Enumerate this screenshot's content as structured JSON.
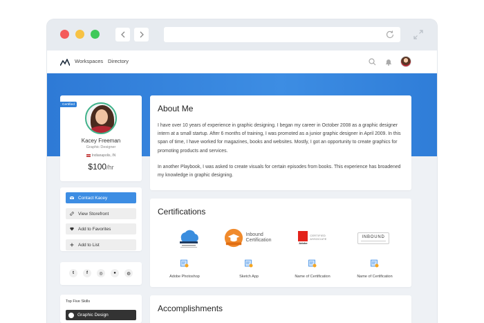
{
  "nav": {
    "workspaces": "Workspaces",
    "directory": "Directory"
  },
  "profile": {
    "badge": "Certified",
    "name": "Kacey Freeman",
    "title": "Graphic Designer",
    "location": "Indianapolis, IN",
    "rate": "$100",
    "rate_unit": "/hr"
  },
  "actions": [
    {
      "label": "Contact Kacey",
      "icon": "mail-icon",
      "primary": true
    },
    {
      "label": "View Storefront",
      "icon": "link-icon",
      "primary": false
    },
    {
      "label": "Add to Favorites",
      "icon": "heart-icon",
      "primary": false
    },
    {
      "label": "Add to List",
      "icon": "plus-icon",
      "primary": false
    }
  ],
  "social": [
    {
      "name": "twitter-icon",
      "glyph": "t"
    },
    {
      "name": "facebook-icon",
      "glyph": "f"
    },
    {
      "name": "instagram-icon",
      "glyph": "◎"
    },
    {
      "name": "github-icon",
      "glyph": "●"
    },
    {
      "name": "dribbble-icon",
      "glyph": "◍"
    }
  ],
  "skills": {
    "title": "Top Five Skills",
    "items": [
      "Graphic Design"
    ]
  },
  "about": {
    "heading": "About Me",
    "p1": "I have over 10 years of experience in graphic designing. I began my career in October 2008 as a graphic designer intern at a small startup. After 6 months of training, I was promoted as a junior graphic designer in April 2009. In this span of time, I have worked for magazines, books and websites. Mostly, I got an opportunity to create graphics for promoting products and services.",
    "p2": "In another Playbook, I was asked to create visuals for certain episodes from books. This experience has broadened my knowledge in graphic designing."
  },
  "certifications": {
    "heading": "Certifications",
    "logos": {
      "inbound_line1": "Inbound",
      "inbound_line2": "Certification",
      "adobe_brand": "Adobe",
      "adobe_line1": "CERTIFIED",
      "adobe_line2": "ASSOCIATE",
      "inbound_box": "INBOUND"
    },
    "items": [
      "Adobe Photoshop",
      "Sketch App",
      "Name of Certification",
      "Name of Certification"
    ]
  },
  "accomplishments": {
    "heading": "Accomplishments"
  },
  "colors": {
    "accent": "#3d8de3",
    "badge": "#2f80d9",
    "avatar_ring": "#3fb28a",
    "skill_pill": "#333333"
  }
}
